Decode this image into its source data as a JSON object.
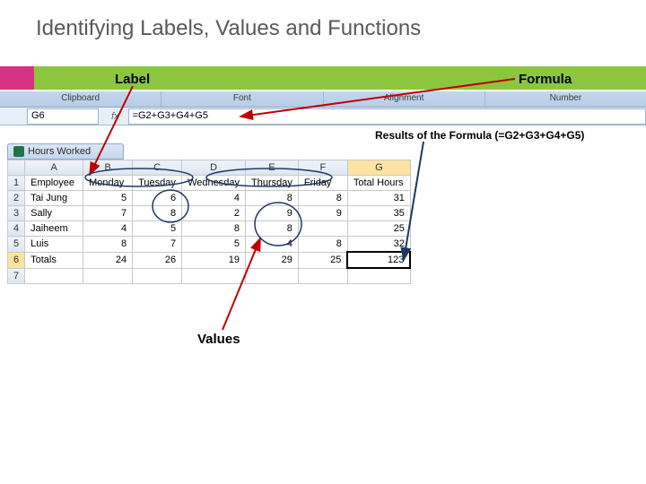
{
  "slide": {
    "title": "Identifying Labels, Values and Functions",
    "annotations": {
      "label": "Label",
      "formula": "Formula",
      "results": "Results of the Formula (=G2+G3+G4+G5)",
      "values": "Values"
    }
  },
  "ribbon": {
    "groups": [
      "Clipboard",
      "Font",
      "Alignment",
      "Number"
    ]
  },
  "formula_bar": {
    "cell_ref": "G6",
    "fx": "fx",
    "formula": "=G2+G3+G4+G5"
  },
  "workbook": {
    "name": "Hours Worked"
  },
  "sheet": {
    "col_headers": [
      "",
      "A",
      "B",
      "C",
      "D",
      "E",
      "F",
      "G"
    ],
    "row_headers": [
      "1",
      "2",
      "3",
      "4",
      "5",
      "6",
      "7"
    ],
    "rows": [
      {
        "A": "Employee",
        "B": "Monday",
        "C": "Tuesday",
        "D": "Wednesday",
        "E": "Thursday",
        "F": "Friday",
        "G": "Total Hours"
      },
      {
        "A": "Tai Jung",
        "B": "5",
        "C": "6",
        "D": "4",
        "E": "8",
        "F": "8",
        "G": "31"
      },
      {
        "A": "Sally",
        "B": "7",
        "C": "8",
        "D": "2",
        "E": "9",
        "F": "9",
        "G": "35"
      },
      {
        "A": "Jaiheem",
        "B": "4",
        "C": "5",
        "D": "8",
        "E": "8",
        "F": "",
        "G": "25"
      },
      {
        "A": "Luis",
        "B": "8",
        "C": "7",
        "D": "5",
        "E": "4",
        "F": "8",
        "G": "32"
      },
      {
        "A": "Totals",
        "B": "24",
        "C": "26",
        "D": "19",
        "E": "29",
        "F": "25",
        "G": "123"
      },
      {
        "A": "",
        "B": "",
        "C": "",
        "D": "",
        "E": "",
        "F": "",
        "G": ""
      }
    ],
    "selected_cell": "G6"
  }
}
